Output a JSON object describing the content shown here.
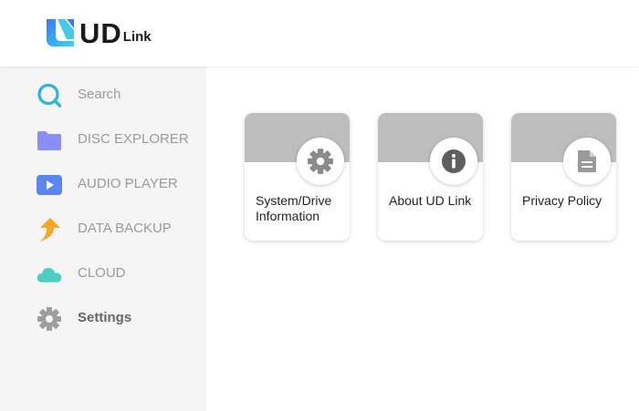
{
  "header": {
    "logo_main": "UD",
    "logo_sub": "Link"
  },
  "sidebar": {
    "items": [
      {
        "label": "Search",
        "icon": "search-icon",
        "color": "#29b6d9"
      },
      {
        "label": "DISC EXPLORER",
        "icon": "folder-icon",
        "color": "#8c8ef7"
      },
      {
        "label": "AUDIO PLAYER",
        "icon": "play-icon",
        "color": "#5b86f0"
      },
      {
        "label": "DATA BACKUP",
        "icon": "upload-arrow-icon",
        "color": "#f5a623"
      },
      {
        "label": "CLOUD",
        "icon": "cloud-icon",
        "color": "#4ecdc4"
      },
      {
        "label": "Settings",
        "icon": "gear-icon",
        "color": "#9e9e9e",
        "active": true
      }
    ]
  },
  "main": {
    "cards": [
      {
        "label": "System/Drive Information",
        "icon": "gear-icon"
      },
      {
        "label": "About UD Link",
        "icon": "info-icon"
      },
      {
        "label": "Privacy Policy",
        "icon": "document-icon"
      }
    ]
  }
}
